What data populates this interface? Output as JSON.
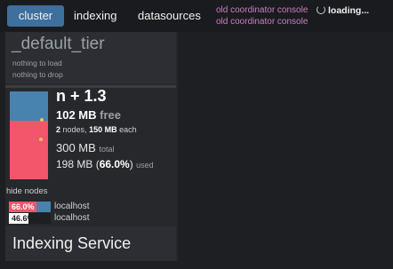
{
  "nav": {
    "tabs": [
      {
        "label": "cluster",
        "active": true
      },
      {
        "label": "indexing",
        "active": false
      },
      {
        "label": "datasources",
        "active": false
      }
    ],
    "legacy_links": [
      "old coordinator console",
      "old coordinator console"
    ],
    "loading_label": "loading..."
  },
  "tier": {
    "title": "_default_tier",
    "lines": [
      "nothing to load",
      "nothing to drop"
    ]
  },
  "server_tier": {
    "name": "n + 1.3",
    "mb_value": "102 MB",
    "mb_free_label": "free",
    "nodes_count": "2",
    "nodes_label": "nodes,",
    "each_value": "150 MB",
    "each_label": "each",
    "total_value": "300 MB",
    "total_label": "total",
    "used_value": "198 MB",
    "used_pct": "66.0%",
    "used_label": "used",
    "used_fraction": 0.66
  },
  "nodes": {
    "toggle_label": "hide nodes",
    "items": [
      {
        "pct": "66.0%",
        "fraction": 0.66,
        "host": "localhost"
      },
      {
        "pct": "46.6%",
        "fraction": 0.466,
        "host": "localhost"
      }
    ]
  },
  "indexing_service": {
    "title": "Indexing Service"
  },
  "colors": {
    "accent": "#3f6f9c",
    "free": "#4783ad",
    "used": "#f2566b",
    "legacy_link": "#c87fc2"
  }
}
